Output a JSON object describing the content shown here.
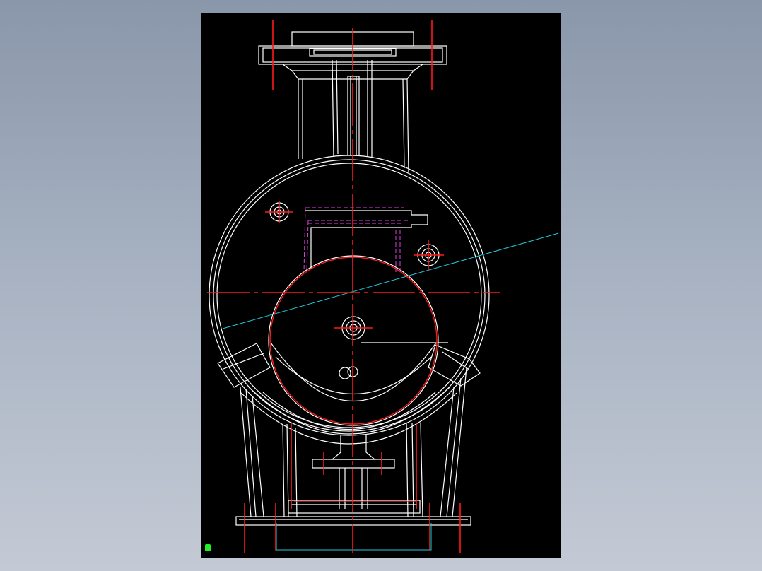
{
  "background_gradient": [
    "#8a97aa",
    "#c3cad5"
  ],
  "viewport": {
    "background": "#000000"
  },
  "colors": {
    "outline": "#ffffff",
    "centerline": "#ff1a1a",
    "hidden": "#e040e0",
    "construction": "#22c8d8",
    "ucs_marker": "#22ee22"
  },
  "icons": {
    "ucs": "ucs-icon"
  }
}
